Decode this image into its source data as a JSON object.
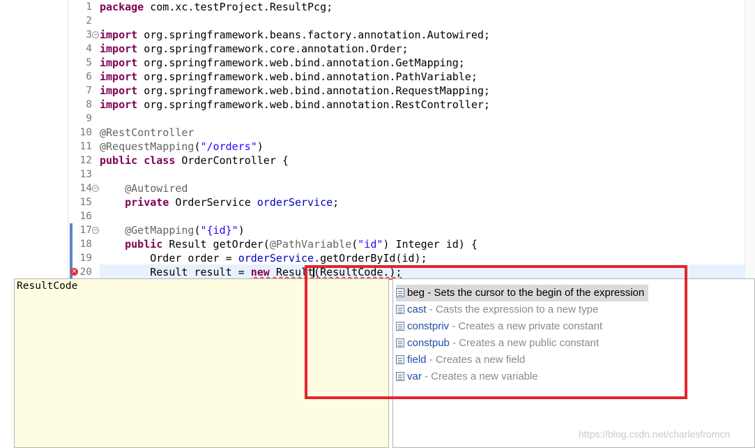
{
  "editor": {
    "lines": [
      {
        "num": "1",
        "tokens": [
          {
            "t": "package",
            "c": "kw"
          },
          {
            "t": " com.xc.testProject.ResultPcg;"
          }
        ]
      },
      {
        "num": "2",
        "tokens": []
      },
      {
        "num": "3",
        "fold": true,
        "tokens": [
          {
            "t": "import",
            "c": "kw"
          },
          {
            "t": " org.springframework.beans.factory.annotation.Autowired;"
          }
        ]
      },
      {
        "num": "4",
        "tokens": [
          {
            "t": "import",
            "c": "kw"
          },
          {
            "t": " org.springframework.core.annotation.Order;"
          }
        ]
      },
      {
        "num": "5",
        "tokens": [
          {
            "t": "import",
            "c": "kw"
          },
          {
            "t": " org.springframework.web.bind.annotation.GetMapping;"
          }
        ]
      },
      {
        "num": "6",
        "tokens": [
          {
            "t": "import",
            "c": "kw"
          },
          {
            "t": " org.springframework.web.bind.annotation.PathVariable;"
          }
        ]
      },
      {
        "num": "7",
        "tokens": [
          {
            "t": "import",
            "c": "kw"
          },
          {
            "t": " org.springframework.web.bind.annotation.RequestMapping;"
          }
        ]
      },
      {
        "num": "8",
        "tokens": [
          {
            "t": "import",
            "c": "kw"
          },
          {
            "t": " org.springframework.web.bind.annotation.RestController;"
          }
        ]
      },
      {
        "num": "9",
        "tokens": []
      },
      {
        "num": "10",
        "tokens": [
          {
            "t": "@RestController",
            "c": "ann"
          }
        ]
      },
      {
        "num": "11",
        "tokens": [
          {
            "t": "@RequestMapping",
            "c": "ann"
          },
          {
            "t": "("
          },
          {
            "t": "\"/orders\"",
            "c": "str"
          },
          {
            "t": ")"
          }
        ]
      },
      {
        "num": "12",
        "tokens": [
          {
            "t": "public",
            "c": "kw"
          },
          {
            "t": " "
          },
          {
            "t": "class",
            "c": "kw"
          },
          {
            "t": " OrderController {"
          }
        ]
      },
      {
        "num": "13",
        "tokens": []
      },
      {
        "num": "14",
        "fold": true,
        "tokens": [
          {
            "t": "    "
          },
          {
            "t": "@Autowired",
            "c": "ann"
          }
        ]
      },
      {
        "num": "15",
        "tokens": [
          {
            "t": "    "
          },
          {
            "t": "private",
            "c": "kw"
          },
          {
            "t": " OrderService "
          },
          {
            "t": "orderService",
            "c": "fld"
          },
          {
            "t": ";"
          }
        ]
      },
      {
        "num": "16",
        "tokens": []
      },
      {
        "num": "17",
        "fold": true,
        "mark": true,
        "tokens": [
          {
            "t": "    "
          },
          {
            "t": "@GetMapping",
            "c": "ann"
          },
          {
            "t": "("
          },
          {
            "t": "\"{id}\"",
            "c": "str"
          },
          {
            "t": ")"
          }
        ]
      },
      {
        "num": "18",
        "mark": true,
        "tokens": [
          {
            "t": "    "
          },
          {
            "t": "public",
            "c": "kw"
          },
          {
            "t": " Result getOrder("
          },
          {
            "t": "@PathVariable",
            "c": "ann"
          },
          {
            "t": "("
          },
          {
            "t": "\"id\"",
            "c": "str"
          },
          {
            "t": ") Integer id) {"
          }
        ]
      },
      {
        "num": "19",
        "mark": true,
        "tokens": [
          {
            "t": "        Order order = "
          },
          {
            "t": "orderService",
            "c": "fld"
          },
          {
            "t": ".getOrderById(id);"
          }
        ]
      },
      {
        "num": "20",
        "error": true,
        "mark": true,
        "tokens": [
          {
            "t": "        Result result = "
          },
          {
            "t": "new",
            "c": "kw squiggle"
          },
          {
            "t": " Result(ResultCode.);",
            "c": "squiggle-part"
          }
        ]
      }
    ]
  },
  "doc_popup": {
    "text": "ResultCode"
  },
  "assist": {
    "proposals": [
      {
        "name": "beg",
        "desc": " - Sets the cursor to the begin of the expression",
        "selected": true
      },
      {
        "name": "cast",
        "desc": " - Casts the expression to a new type"
      },
      {
        "name": "constpriv",
        "desc": " - Creates a new private constant"
      },
      {
        "name": "constpub",
        "desc": " - Creates a new public constant"
      },
      {
        "name": "field",
        "desc": " - Creates a new field"
      },
      {
        "name": "var",
        "desc": " - Creates a new variable"
      }
    ]
  },
  "watermark": "https://blog.csdn.net/charlesfromcn",
  "colors": {
    "highlight_border": "#e3262c",
    "keyword": "#7f0055",
    "string": "#2a00ff",
    "field": "#0000c0"
  }
}
